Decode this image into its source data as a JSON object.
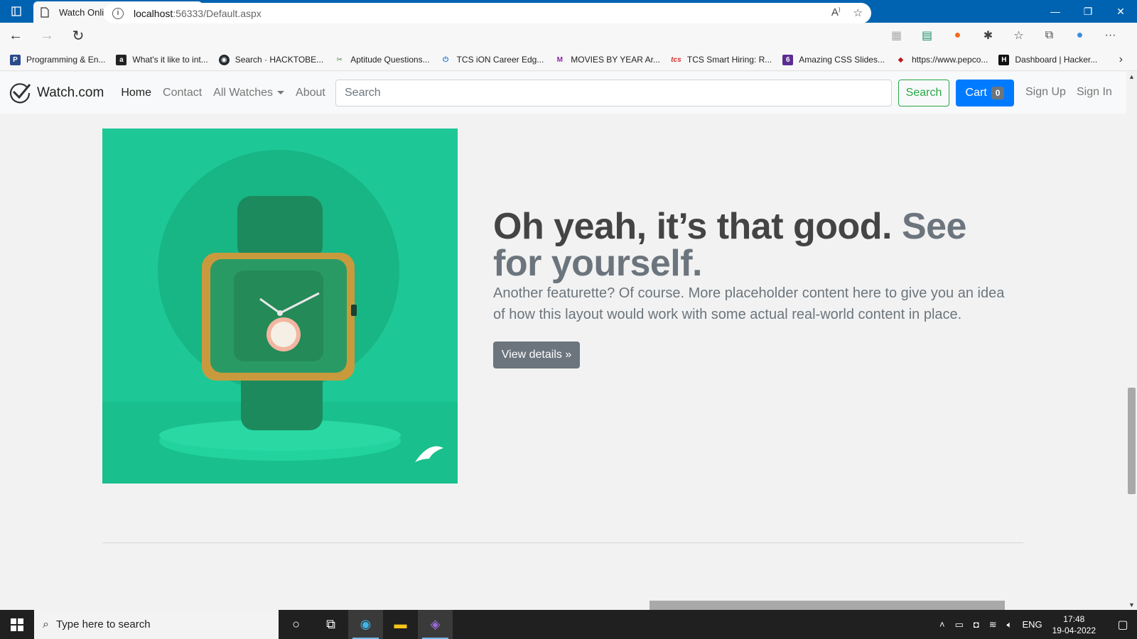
{
  "browser": {
    "tab_title": "Watch Online Shopping",
    "url_host": "localhost",
    "url_path": ":56333/Default.aspx",
    "bookmarks": [
      {
        "label": "Programming & En...",
        "icon": "bookmark-programming-icon",
        "color": "#2b4a8b"
      },
      {
        "label": "What's it like to int...",
        "icon": "bookmark-amazon-icon",
        "color": "#222222"
      },
      {
        "label": "Search · HACKTOBE...",
        "icon": "bookmark-github-icon",
        "color": "#24292e"
      },
      {
        "label": "Aptitude Questions...",
        "icon": "bookmark-indiabix-icon",
        "color": "#3c8c3c"
      },
      {
        "label": "TCS iON Career Edg...",
        "icon": "bookmark-power-icon",
        "color": "#1a73e8"
      },
      {
        "label": "MOVIES BY YEAR Ar...",
        "icon": "bookmark-gmail-icon",
        "color": "#8e24aa"
      },
      {
        "label": "TCS Smart Hiring: R...",
        "icon": "bookmark-tcs-icon",
        "color": "#d32f2f"
      },
      {
        "label": "Amazing CSS Slides...",
        "icon": "bookmark-six-icon",
        "color": "#5c2d91"
      },
      {
        "label": "https://www.pepco...",
        "icon": "bookmark-cube-icon",
        "color": "#b71c1c"
      },
      {
        "label": "Dashboard | Hacker...",
        "icon": "bookmark-hackerrank-icon",
        "color": "#111111"
      }
    ]
  },
  "navbar": {
    "brand": "Watch.com",
    "links": {
      "home": "Home",
      "contact": "Contact",
      "all_watches": "All Watches",
      "about": "About"
    },
    "search_placeholder": "Search",
    "search_button": "Search",
    "cart_label": "Cart",
    "cart_count": "0",
    "sign_up": "Sign Up",
    "sign_in": "Sign In"
  },
  "featurette": {
    "heading": "Oh yeah, it’s that good.",
    "heading_muted": "See for yourself.",
    "lead": "Another featurette? Of course. More placeholder content here to give you an idea of how this layout would work with some actual real-world content in place.",
    "button": "View details »",
    "image_bg": "#1ec896"
  },
  "taskbar": {
    "search_placeholder": "Type here to search",
    "language": "ENG",
    "time": "17:48",
    "date": "19-04-2022"
  }
}
